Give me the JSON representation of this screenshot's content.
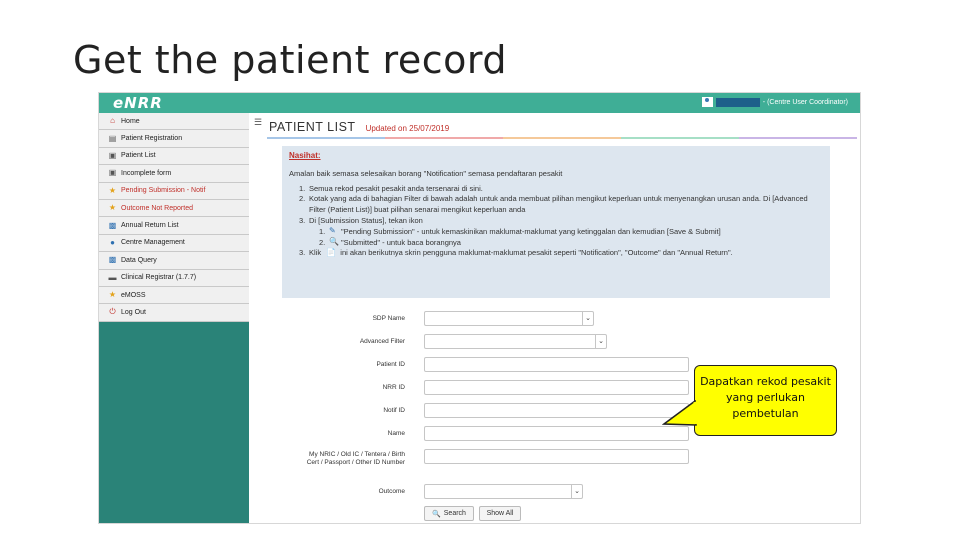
{
  "slide": {
    "title": "Get the patient record",
    "callout": "Dapatkan rekod pesakit yang perlukan pembetulan"
  },
  "app": {
    "logo": "eNRR",
    "user_role": "- (Centre User Coordinator)"
  },
  "sidebar": {
    "items": [
      {
        "label": "Home",
        "icon": "home-icon",
        "color": "normal"
      },
      {
        "label": "Patient Registration",
        "icon": "document-icon",
        "color": "normal"
      },
      {
        "label": "Patient List",
        "icon": "clipboard-icon",
        "color": "normal"
      },
      {
        "label": "Incomplete form",
        "icon": "clipboard-icon",
        "color": "normal"
      },
      {
        "label": "Pending Submission - Notif",
        "icon": "star-icon",
        "color": "red"
      },
      {
        "label": "Outcome Not Reported",
        "icon": "star-icon",
        "color": "red"
      },
      {
        "label": "Annual Return List",
        "icon": "chart-icon",
        "color": "normal"
      },
      {
        "label": "Centre Management",
        "icon": "users-icon",
        "color": "normal"
      },
      {
        "label": "Data Query",
        "icon": "chart-icon",
        "color": "normal"
      },
      {
        "label": "Clinical Registrar (1.7.7)",
        "icon": "folder-icon",
        "color": "normal"
      },
      {
        "label": "eMOSS",
        "icon": "star-icon",
        "color": "normal"
      },
      {
        "label": "Log Out",
        "icon": "power-icon",
        "color": "normal"
      }
    ]
  },
  "main": {
    "title": "PATIENT LIST",
    "updated": "Updated on 25/07/2019",
    "notice": {
      "title": "Nasihat:",
      "intro": "Amalan baik semasa selesaikan borang \"Notification\" semasa pendaftaran pesakit",
      "steps": [
        {
          "num": "1.",
          "text": "Semua rekod pesakit pesakit anda tersenarai di sini."
        },
        {
          "num": "2.",
          "text": "Kotak yang ada di bahagian Filter di bawah adalah untuk anda membuat pilihan mengikut keperluan untuk menyenangkan urusan anda. Di [Advanced Filter (Patient List)] buat pilihan senarai mengikut keperluan anda"
        },
        {
          "num": "3.",
          "text": "Di [Submission Status], tekan ikon"
        }
      ],
      "substeps": [
        {
          "num": "1.",
          "icon": "edit-icon",
          "text": "\"Pending Submission\" - untuk kemaskinikan maklumat-maklumat yang ketinggalan dan kemudian [Save & Submit]"
        },
        {
          "num": "2.",
          "icon": "magnifier-icon",
          "text": "\"Submitted\" - untuk baca borangnya"
        }
      ],
      "step4": {
        "num": "3.",
        "prefix": "Klik",
        "icon": "form-icon",
        "text": "ini akan berikutnya skrin pengguna maklumat-maklumat pesakit seperti \"Notification\", \"Outcome\" dan \"Annual Return\"."
      }
    },
    "form": {
      "site_name_label": "SDP Name",
      "advanced_filter_label": "Advanced Filter",
      "patient_id_label": "Patient ID",
      "nrr_id_label": "NRR ID",
      "notif_id_label": "Notif ID",
      "name_label": "Name",
      "ic_label_line1": "My NRIC / Old IC / Tentera / Birth",
      "ic_label_line2": "Cert / Passport / Other ID Number",
      "outcome_label": "Outcome",
      "search_button": "Search",
      "show_all_button": "Show All"
    }
  },
  "colors": {
    "teal": "#3fae96",
    "sidebar_dark": "#2a8378",
    "red": "#c0302a",
    "notice_bg": "#dde6ef",
    "callout_bg": "#ffff00"
  }
}
